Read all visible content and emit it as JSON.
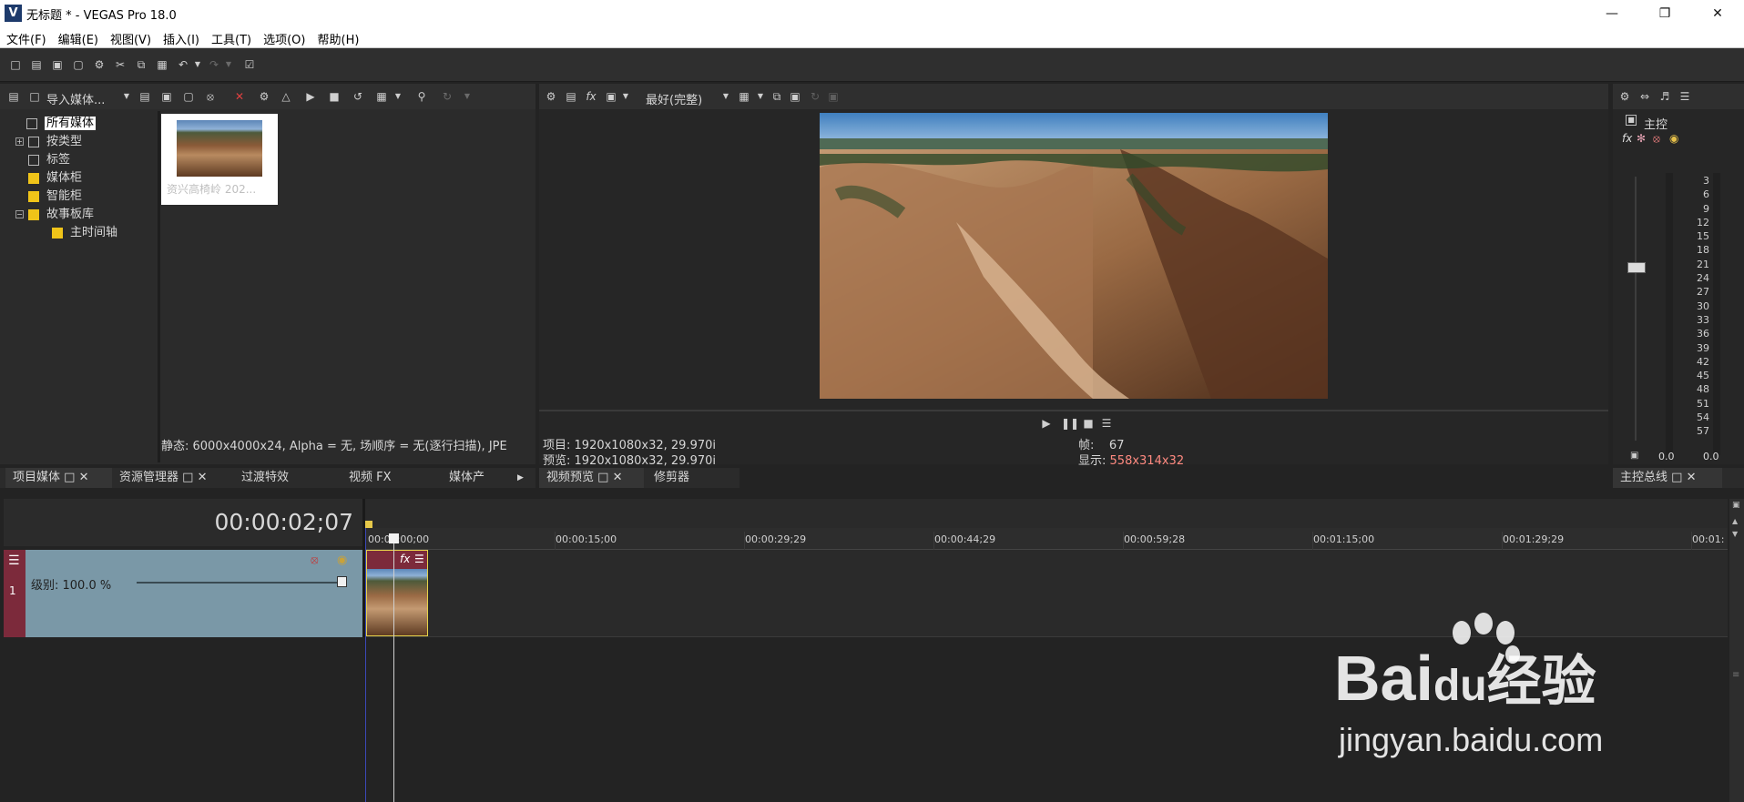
{
  "window": {
    "title": "无标题 * - VEGAS Pro 18.0",
    "logo_letter": "V"
  },
  "menu": [
    "文件(F)",
    "编辑(E)",
    "视图(V)",
    "插入(I)",
    "工具(T)",
    "选项(O)",
    "帮助(H)"
  ],
  "project_media": {
    "import_label": "导入媒体...",
    "tree": [
      {
        "label": "所有媒体",
        "selected": true
      },
      {
        "label": "按类型",
        "expandable": "+"
      },
      {
        "label": "标签"
      },
      {
        "label": "媒体柜"
      },
      {
        "label": "智能柜"
      },
      {
        "label": "故事板库",
        "expandable": "−"
      },
      {
        "label": "主时间轴"
      }
    ],
    "thumb_caption": "资兴高椅岭 202...",
    "status": "静态: 6000x4000x24, Alpha = 无, 场顺序 = 无(逐行扫描), JPE"
  },
  "tabs_left": [
    "项目媒体",
    "资源管理器",
    "过渡特效",
    "视频 FX",
    "媒体产"
  ],
  "preview": {
    "quality": "最好(完整)",
    "project_label": "项目:",
    "project_value": "1920x1080x32, 29.970i",
    "preview_label": "预览:",
    "preview_value": "1920x1080x32, 29.970i",
    "frame_label": "帧:",
    "frame_value": "67",
    "display_label": "显示:",
    "display_value": "558x314x32",
    "display_color": "#ff8a80"
  },
  "tabs_mid": [
    "视频预览",
    "修剪器"
  ],
  "master": {
    "label": "主控",
    "db_scale": [
      "3",
      "6",
      "9",
      "12",
      "15",
      "18",
      "21",
      "24",
      "27",
      "30",
      "33",
      "36",
      "39",
      "42",
      "45",
      "48",
      "51",
      "54",
      "57"
    ],
    "left_value": "0.0",
    "right_value": "0.0",
    "tab": "主控总线"
  },
  "timeline": {
    "timecode": "00:00:02;07",
    "track_number": "1",
    "level_label": "级别: 100.0 %",
    "track_color": "#7c2a3b",
    "ruler": [
      "00:00:00;00",
      "00:00:15;00",
      "00:00:29;29",
      "00:00:44;29",
      "00:00:59;28",
      "00:01:15;00",
      "00:01:29;29",
      "00:01:"
    ]
  },
  "watermark": {
    "brand": "Bai",
    "du": "du",
    "suffix": "经验",
    "url": "jingyan.baidu.com"
  }
}
